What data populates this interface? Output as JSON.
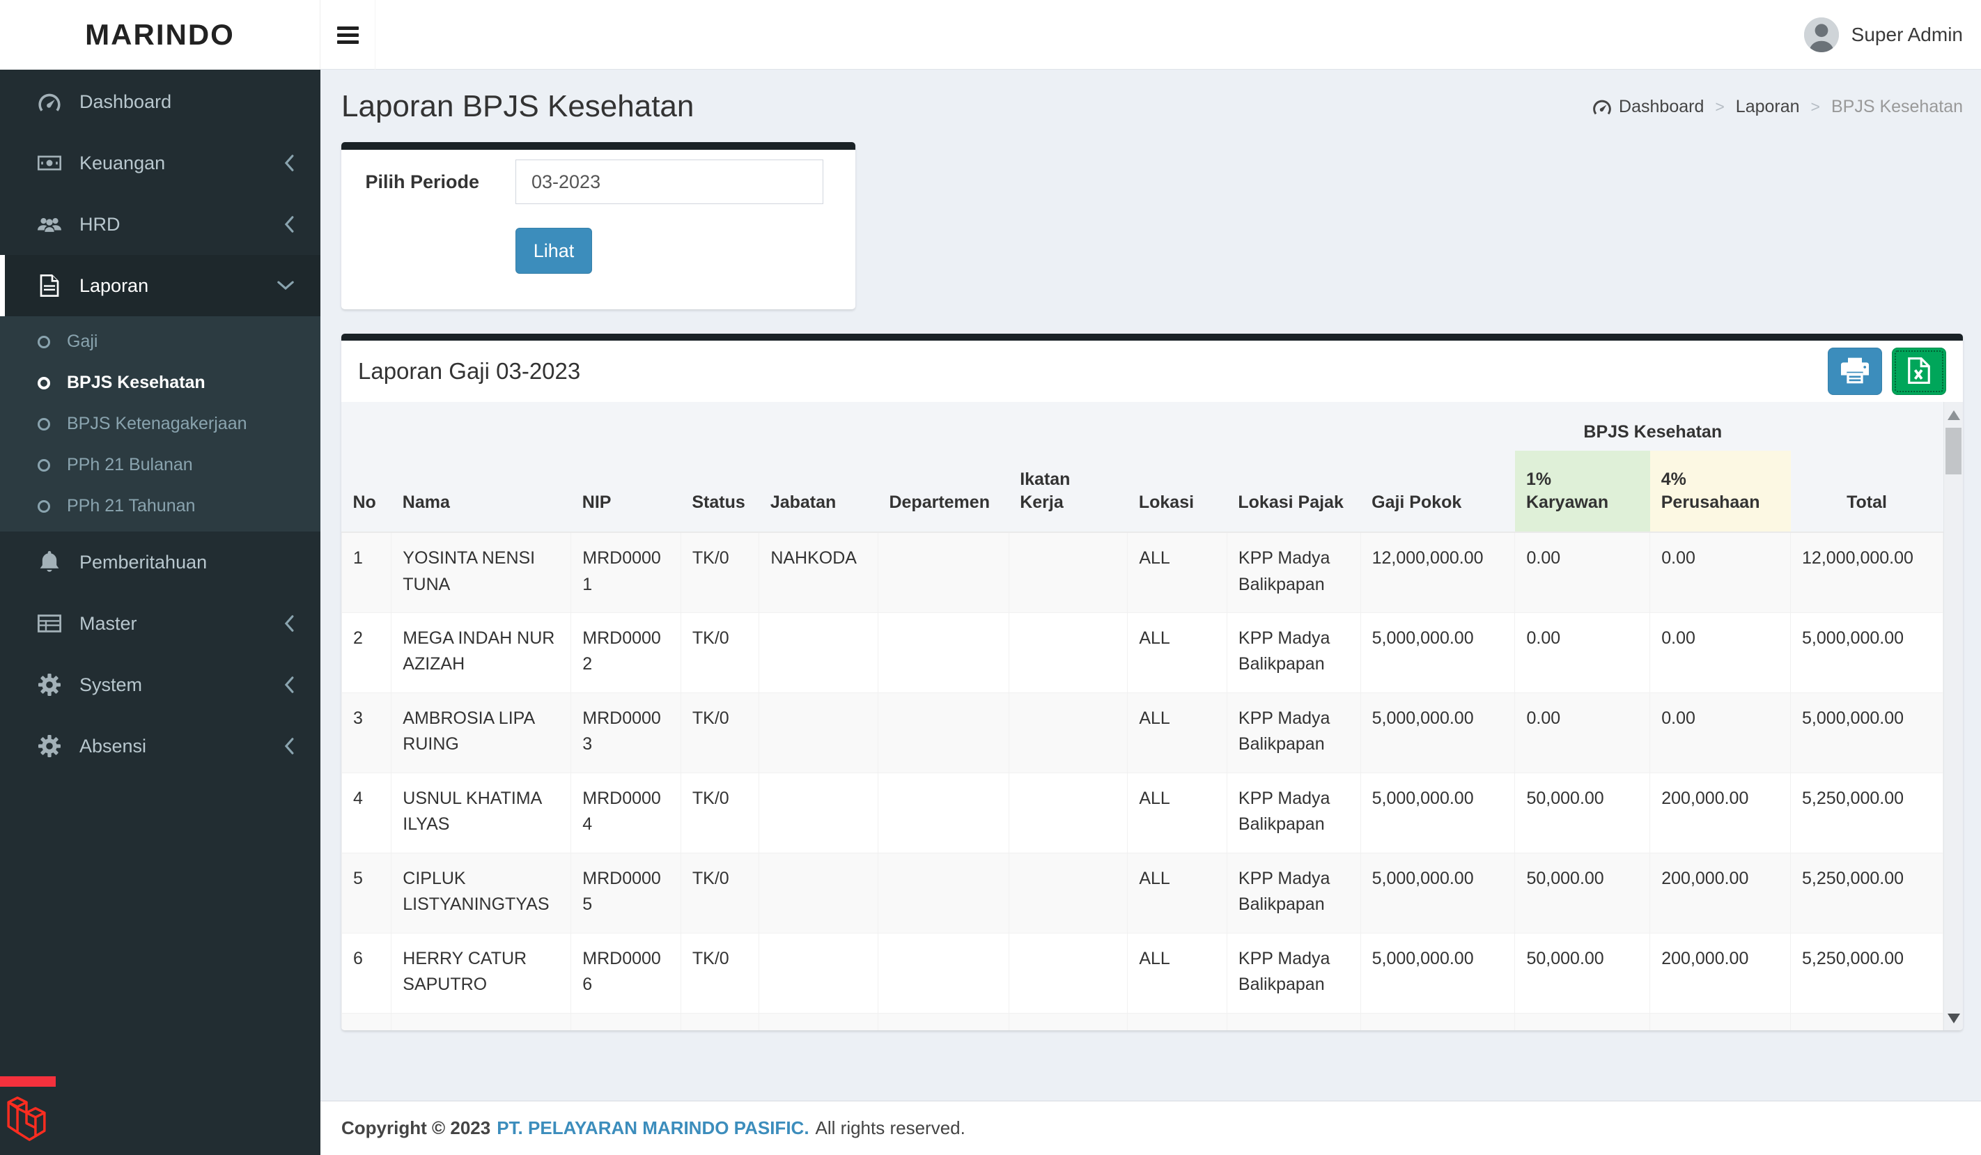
{
  "brand": "MARINDO",
  "topbar": {
    "user": "Super Admin"
  },
  "sidebar": {
    "items": [
      {
        "label": "Dashboard",
        "icon": "tachometer-icon"
      },
      {
        "label": "Keuangan",
        "icon": "money-icon",
        "state": "collapsed"
      },
      {
        "label": "HRD",
        "icon": "users-icon",
        "state": "collapsed"
      },
      {
        "label": "Laporan",
        "icon": "file-text-icon",
        "state": "expanded",
        "active": true,
        "children": [
          {
            "label": "Gaji",
            "active": false
          },
          {
            "label": "BPJS Kesehatan",
            "active": true
          },
          {
            "label": "BPJS Ketenagakerjaan",
            "active": false
          },
          {
            "label": "PPh 21 Bulanan",
            "active": false
          },
          {
            "label": "PPh 21 Tahunan",
            "active": false
          }
        ]
      },
      {
        "label": "Pemberitahuan",
        "icon": "bell-icon"
      },
      {
        "label": "Master",
        "icon": "table-icon",
        "state": "collapsed"
      },
      {
        "label": "System",
        "icon": "gear-icon",
        "state": "collapsed"
      },
      {
        "label": "Absensi",
        "icon": "gear-icon",
        "state": "collapsed"
      }
    ]
  },
  "page": {
    "title": "Laporan BPJS Kesehatan",
    "breadcrumb": [
      "Dashboard",
      "Laporan",
      "BPJS Kesehatan"
    ],
    "breadcrumb_separator": ">"
  },
  "filter": {
    "label": "Pilih Periode",
    "period_value": "03-2023",
    "button_label": "Lihat"
  },
  "report": {
    "title": "Laporan Gaji 03-2023",
    "group_header": "BPJS Kesehatan",
    "columns": [
      "No",
      "Nama",
      "NIP",
      "Status",
      "Jabatan",
      "Departemen",
      "Ikatan Kerja",
      "Lokasi",
      "Lokasi Pajak",
      "Gaji Pokok",
      "1% Karyawan",
      "4% Perusahaan",
      "Total"
    ],
    "rows": [
      [
        "1",
        "YOSINTA NENSI TUNA",
        "MRD00001",
        "TK/0",
        "NAHKODA",
        "",
        "",
        "ALL",
        "KPP Madya Balikpapan",
        "12,000,000.00",
        "0.00",
        "0.00",
        "12,000,000.00"
      ],
      [
        "2",
        "MEGA INDAH NUR AZIZAH",
        "MRD00002",
        "TK/0",
        "",
        "",
        "",
        "ALL",
        "KPP Madya Balikpapan",
        "5,000,000.00",
        "0.00",
        "0.00",
        "5,000,000.00"
      ],
      [
        "3",
        "AMBROSIA LIPA RUING",
        "MRD00003",
        "TK/0",
        "",
        "",
        "",
        "ALL",
        "KPP Madya Balikpapan",
        "5,000,000.00",
        "0.00",
        "0.00",
        "5,000,000.00"
      ],
      [
        "4",
        "USNUL KHATIMA ILYAS",
        "MRD00004",
        "TK/0",
        "",
        "",
        "",
        "ALL",
        "KPP Madya Balikpapan",
        "5,000,000.00",
        "50,000.00",
        "200,000.00",
        "5,250,000.00"
      ],
      [
        "5",
        "CIPLUK LISTYANINGTYAS",
        "MRD00005",
        "TK/0",
        "",
        "",
        "",
        "ALL",
        "KPP Madya Balikpapan",
        "5,000,000.00",
        "50,000.00",
        "200,000.00",
        "5,250,000.00"
      ],
      [
        "6",
        "HERRY CATUR SAPUTRO",
        "MRD00006",
        "TK/0",
        "",
        "",
        "",
        "ALL",
        "KPP Madya Balikpapan",
        "5,000,000.00",
        "50,000.00",
        "200,000.00",
        "5,250,000.00"
      ]
    ]
  },
  "footer": {
    "copyright": "Copyright © 2023",
    "company": "PT. PELAYARAN MARINDO PASIFIC.",
    "rights": "All rights reserved."
  },
  "colors": {
    "accent": "#3c8dbc",
    "excel_green": "#00a65a",
    "sidebar_bg": "#222d32",
    "submenu_bg": "#2c3b41",
    "active_parent_bg": "#1e282c",
    "content_bg": "#ecf0f5",
    "card_top_border": "#1a2226",
    "header_green": "#dff0d8",
    "header_yellow": "#fcf8e3",
    "stripe": "#f9f9f9",
    "link": "#3c8dbc",
    "debugbar_red": "#f5313d"
  }
}
